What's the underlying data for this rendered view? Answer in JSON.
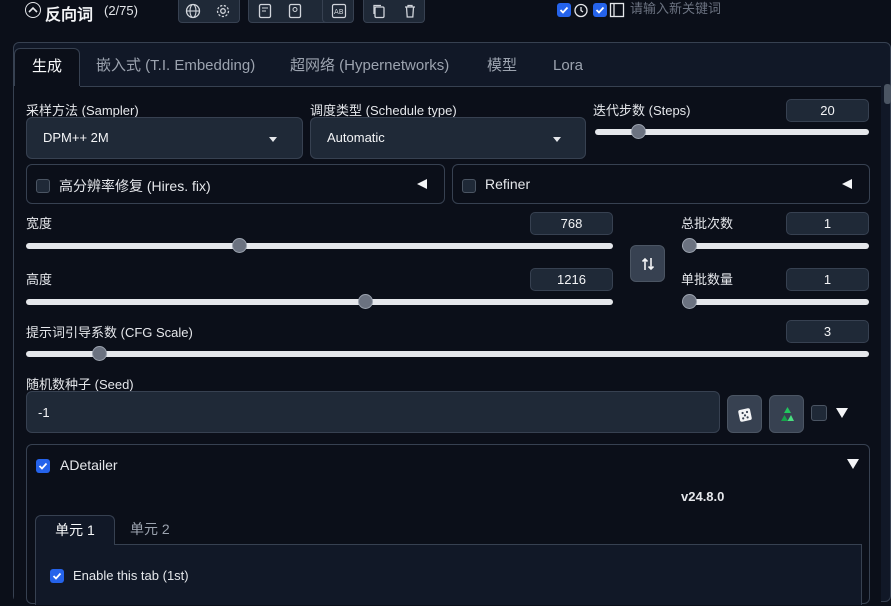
{
  "negative_prompt": {
    "title": "反向词",
    "count": "(2/75)",
    "keyword_placeholder": "请输入新关键词",
    "toolbar_icons": [
      "globe-icon",
      "gear-icon",
      "note-icon",
      "bookmark-icon",
      "ab-icon",
      "copy-icon",
      "trash-icon"
    ]
  },
  "tabs": [
    {
      "label": "生成",
      "active": true
    },
    {
      "label": "嵌入式 (T.I. Embedding)"
    },
    {
      "label": "超网络 (Hypernetworks)"
    },
    {
      "label": "模型"
    },
    {
      "label": "Lora"
    }
  ],
  "sampler": {
    "label": "采样方法 (Sampler)",
    "value": "DPM++ 2M"
  },
  "schedule": {
    "label": "调度类型 (Schedule type)",
    "value": "Automatic"
  },
  "steps": {
    "label": "迭代步数 (Steps)",
    "value": "20",
    "fraction": 0.14
  },
  "hires": {
    "label": "高分辨率修复 (Hires. fix)"
  },
  "refiner": {
    "label": "Refiner"
  },
  "width": {
    "label": "宽度",
    "value": "768",
    "fraction": 0.36
  },
  "height": {
    "label": "高度",
    "value": "1216",
    "fraction": 0.58
  },
  "batch_count": {
    "label": "总批次数",
    "value": "1",
    "fraction": 0.0
  },
  "batch_size": {
    "label": "单批数量",
    "value": "1",
    "fraction": 0.0
  },
  "cfg": {
    "label": "提示词引导系数 (CFG Scale)",
    "value": "3",
    "fraction": 0.08
  },
  "seed": {
    "label": "随机数种子 (Seed)",
    "value": "-1"
  },
  "adetailer": {
    "label": "ADetailer",
    "version": "v24.8.0",
    "tabs": [
      {
        "label": "单元 1",
        "active": true
      },
      {
        "label": "单元 2"
      }
    ],
    "enable_tab": "Enable this tab (1st)"
  },
  "colors": {
    "accent": "#2563eb",
    "background": "#0b0f19",
    "panel": "#1f2937"
  }
}
